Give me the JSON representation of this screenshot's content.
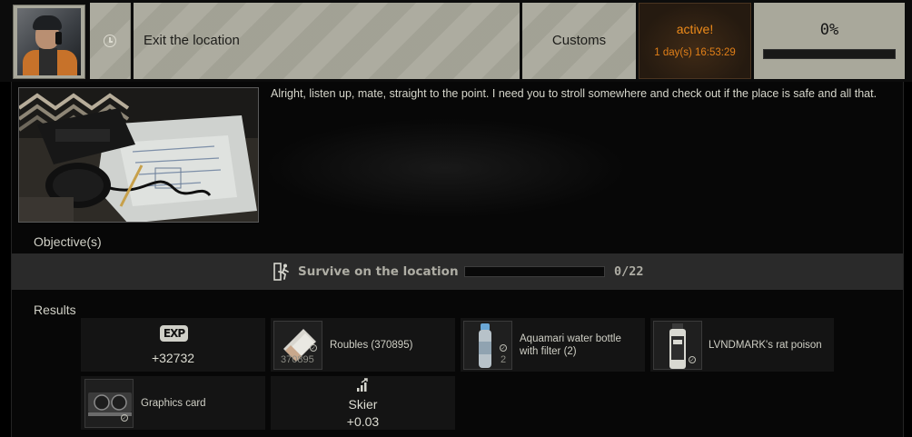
{
  "quest": {
    "title": "Exit the location",
    "location": "Customs",
    "status": "active!",
    "timer": "1 day(s) 16:53:29",
    "progress_percent": "0%",
    "progress_value": 0,
    "description": "Alright, listen up, mate, straight to the point. I need you to stroll somewhere and check out if the place is safe and all that."
  },
  "objectives": {
    "heading": "Objective(s)",
    "items": [
      {
        "text": "Survive on the location",
        "count": "0/22",
        "current": 0,
        "total": 22,
        "icon": "exit-run-icon"
      }
    ]
  },
  "results": {
    "heading": "Results",
    "exp": {
      "badge": "EXP",
      "value": "+32732"
    },
    "items": [
      {
        "name": "Roubles (370895)",
        "sub": "370895",
        "icon": "roubles-icon"
      },
      {
        "name": "Aquamari water bottle with filter (2)",
        "sub": "2",
        "icon": "water-bottle-icon"
      },
      {
        "name": "LVNDMARK's rat poison",
        "sub": "",
        "icon": "rat-poison-icon"
      },
      {
        "name": "Graphics card",
        "sub": "",
        "icon": "graphics-card-icon"
      }
    ],
    "standing": {
      "trader": "Skier",
      "value": "+0.03",
      "icon": "standing-up-icon"
    }
  },
  "colors": {
    "panel_tan": "#a9a89b",
    "active_orange": "#ee8b1a",
    "objective_bar": "#2a2a2a"
  }
}
